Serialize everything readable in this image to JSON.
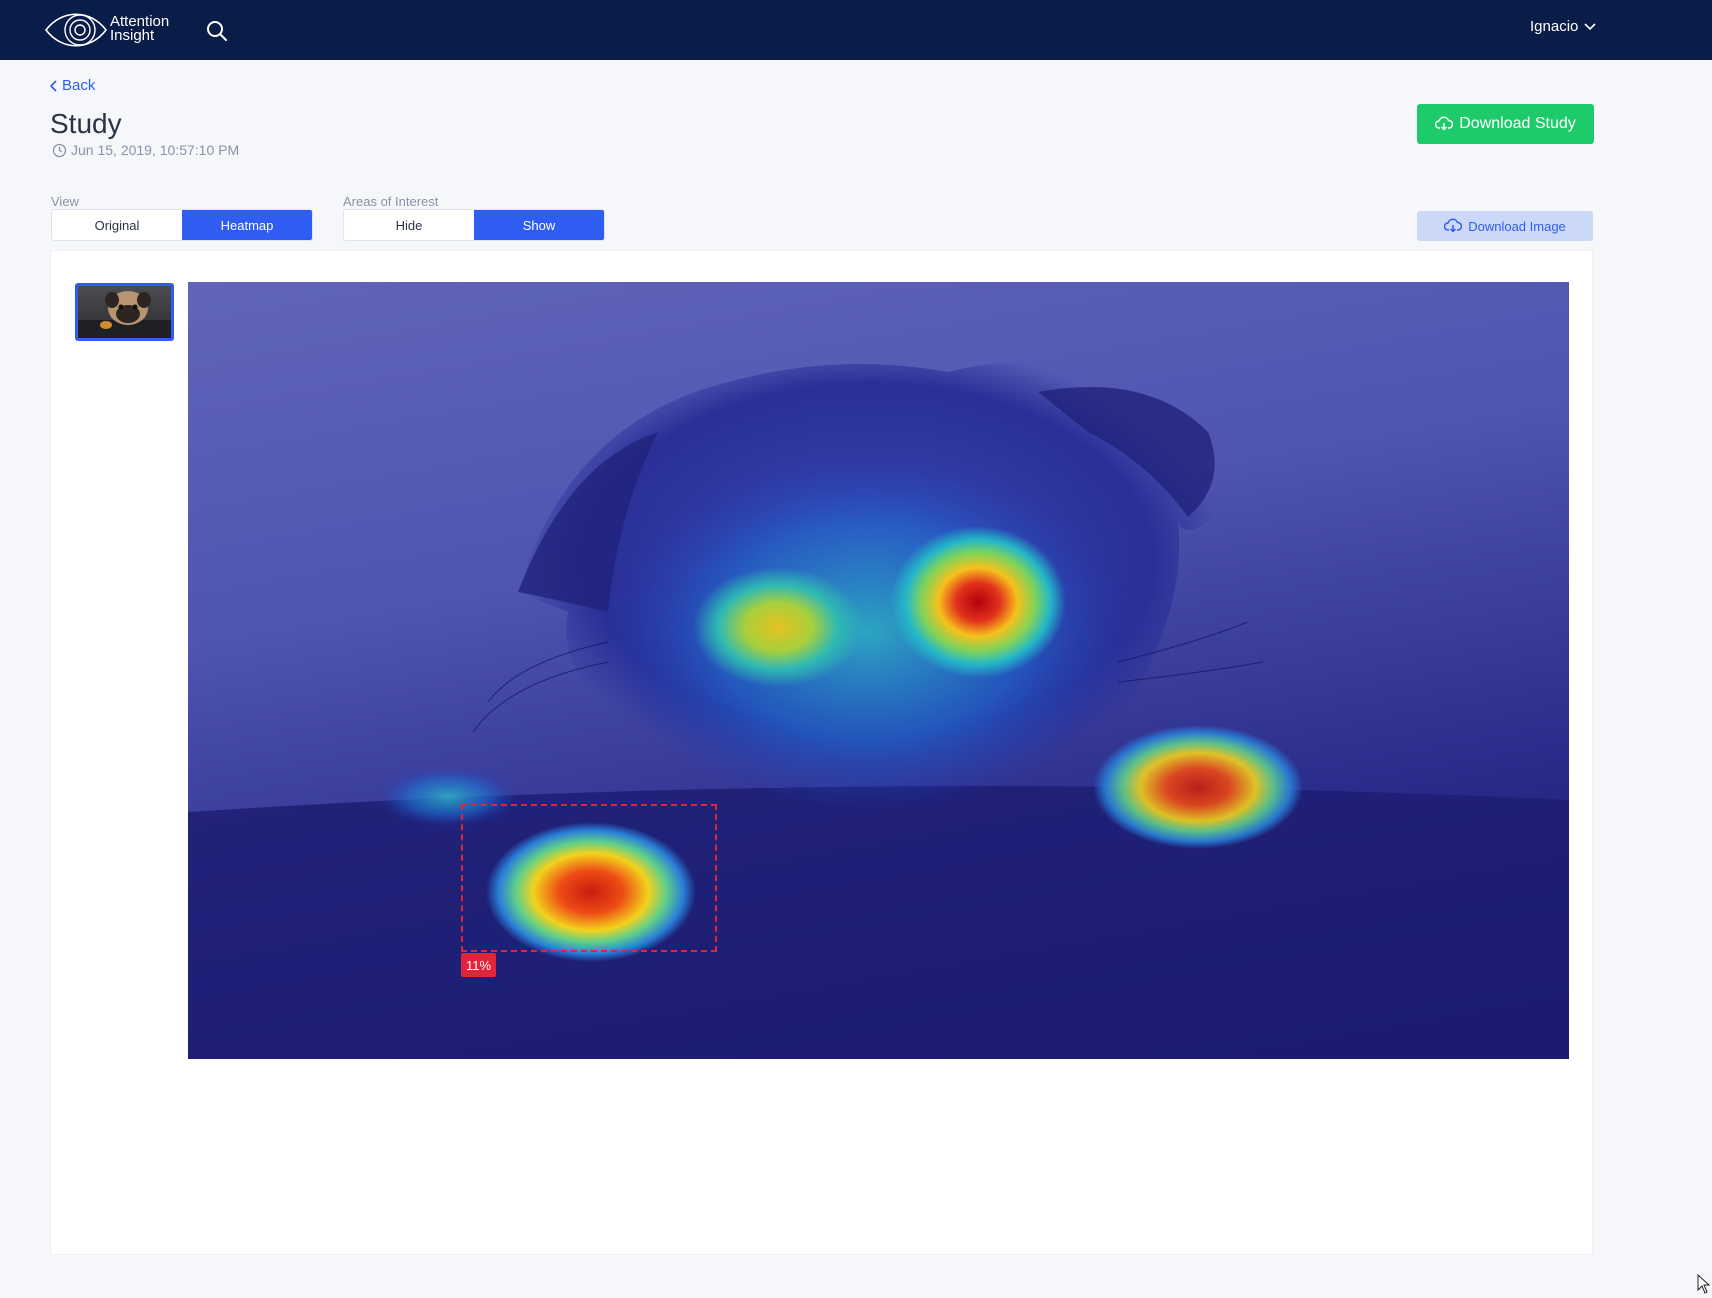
{
  "header": {
    "logo_line1": "Attention",
    "logo_line2": "Insight",
    "user_name": "Ignacio"
  },
  "nav": {
    "back_label": "Back"
  },
  "study": {
    "title": "Study",
    "timestamp": "Jun 15, 2019, 10:57:10 PM",
    "download_study_label": "Download Study",
    "download_image_label": "Download Image"
  },
  "view_toggle": {
    "label": "View",
    "options": [
      "Original",
      "Heatmap"
    ],
    "selected": "Heatmap"
  },
  "aoi_toggle": {
    "label": "Areas of Interest",
    "options": [
      "Hide",
      "Show"
    ],
    "selected": "Show"
  },
  "areas_of_interest": [
    {
      "label": "11%"
    }
  ],
  "colors": {
    "topbar": "#0a1c48",
    "accent": "#2f5cf1",
    "success": "#1ecb6b",
    "aoi": "#e0243a"
  }
}
